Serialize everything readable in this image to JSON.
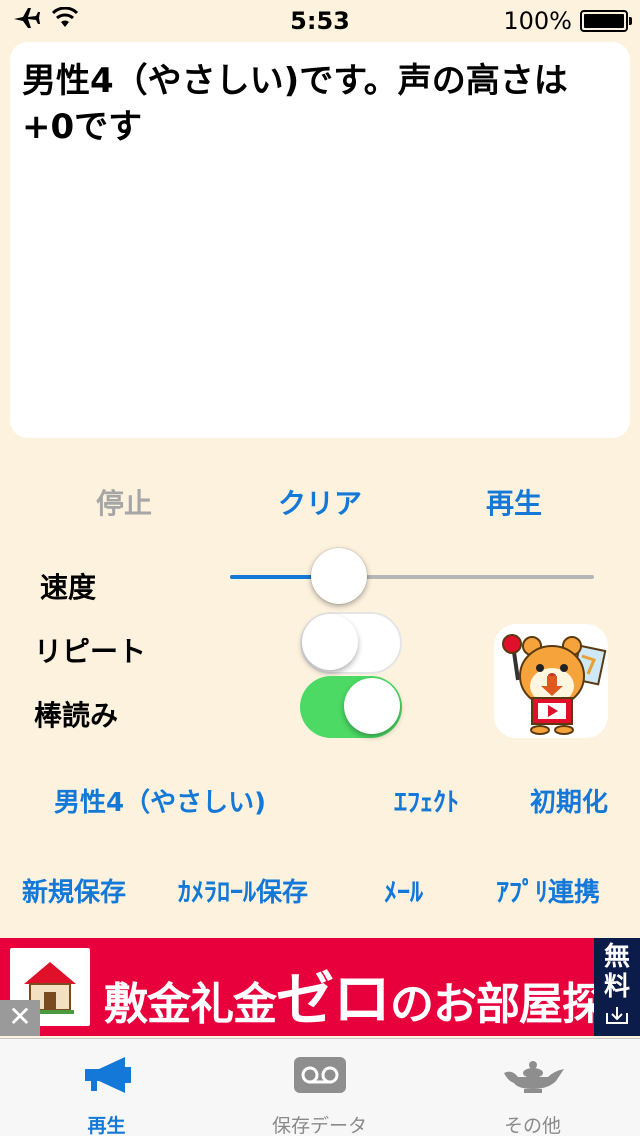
{
  "status_bar": {
    "time": "5:53",
    "battery": "100%"
  },
  "text_area": {
    "content": "男性4（やさしい)です。声の高さは+0です"
  },
  "controls": {
    "stop": "停止",
    "clear": "クリア",
    "play": "再生"
  },
  "settings": {
    "speed_label": "速度",
    "speed_value": 0.3,
    "repeat_label": "リピート",
    "repeat_on": false,
    "monotone_label": "棒読み",
    "monotone_on": true
  },
  "voice_row": {
    "voice": "男性4（やさしい)",
    "effect": "ｴﾌｪｸﾄ",
    "reset": "初期化"
  },
  "save_row": {
    "new_save": "新規保存",
    "camera_roll_save": "ｶﾒﾗﾛｰﾙ保存",
    "mail": "ﾒｰﾙ",
    "app_link": "ｱﾌﾟﾘ連携"
  },
  "ad": {
    "text_pre": "敷金礼金",
    "text_big": "ゼロ",
    "text_post": "のお部屋探し",
    "free_badge": "無料"
  },
  "tab_bar": {
    "tabs": [
      {
        "label": "再生",
        "icon": "megaphone-icon",
        "active": true
      },
      {
        "label": "保存データ",
        "icon": "voicemail-icon",
        "active": false
      },
      {
        "label": "その他",
        "icon": "genie-lamp-icon",
        "active": false
      }
    ]
  },
  "colors": {
    "accent": "#1478d8",
    "background": "#fdf2de",
    "toggle_on": "#4cd964",
    "ad_background": "#e8003d"
  }
}
